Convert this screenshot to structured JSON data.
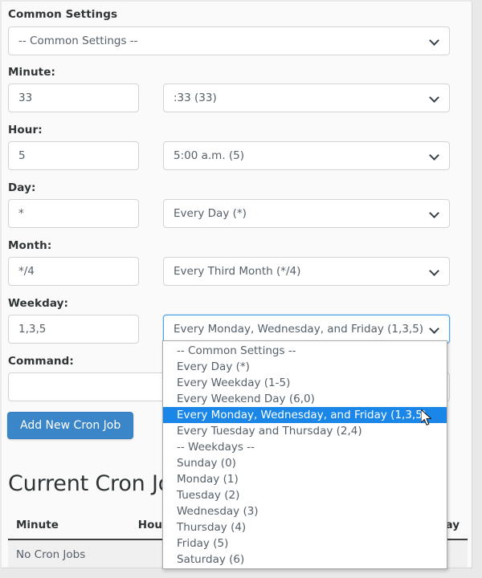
{
  "page": {
    "background": "#e9e9e9",
    "panel_background": "#fafafa",
    "accent_color": "#3a86c8",
    "highlight_color": "#1a87e8"
  },
  "form": {
    "common_settings": {
      "label": "Common Settings",
      "select_value": "-- Common Settings --"
    },
    "rows": [
      {
        "label": "Minute:",
        "input_value": "33",
        "select_value": ":33 (33)",
        "focused": false
      },
      {
        "label": "Hour:",
        "input_value": "5",
        "select_value": "5:00 a.m. (5)",
        "focused": false
      },
      {
        "label": "Day:",
        "input_value": "*",
        "select_value": "Every Day (*)",
        "focused": false
      },
      {
        "label": "Month:",
        "input_value": "*/4",
        "select_value": "Every Third Month (*/4)",
        "focused": false
      },
      {
        "label": "Weekday:",
        "input_value": "1,3,5",
        "select_value": "Every Monday, Wednesday, and Friday (1,3,5)",
        "focused": true
      }
    ],
    "command": {
      "label": "Command:",
      "value": "",
      "placeholder": ""
    },
    "submit_label": "Add New Cron Job"
  },
  "weekday_dropdown": {
    "open": true,
    "selected_index": 4,
    "options": [
      "-- Common Settings --",
      "Every Day (*)",
      "Every Weekday (1-5)",
      "Every Weekend Day (6,0)",
      "Every Monday, Wednesday, and Friday (1,3,5)",
      "Every Tuesday and Thursday (2,4)",
      "-- Weekdays --",
      "Sunday (0)",
      "Monday (1)",
      "Tuesday (2)",
      "Wednesday (3)",
      "Thursday (4)",
      "Friday (5)",
      "Saturday (6)"
    ]
  },
  "current_jobs": {
    "title": "Current Cron Jobs",
    "columns": [
      "Minute",
      "Hour",
      "Weekday"
    ],
    "empty_message": "No Cron Jobs"
  },
  "icons": {
    "chevron_down": "chevron-down-icon",
    "cursor": "mouse-pointer-icon"
  }
}
